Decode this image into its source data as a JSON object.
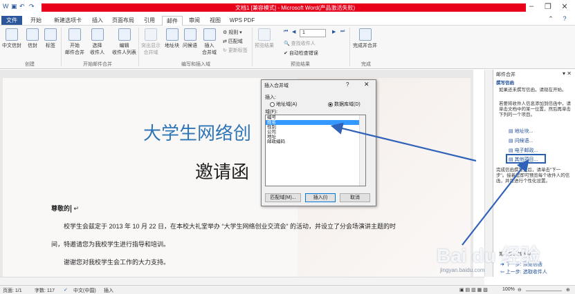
{
  "titlebar": {
    "title": "文档1 [兼容模式] - Microsoft Word(产品激活失败)",
    "accent": "#e8001a"
  },
  "tabs": [
    "文件",
    "开始",
    "新建选项卡",
    "插入",
    "页面布局",
    "引用",
    "邮件",
    "审阅",
    "视图",
    "WPS PDF"
  ],
  "active_tab": "邮件",
  "ribbon": {
    "create": {
      "btn1": "中文信封",
      "btn2": "信封",
      "btn3": "标签",
      "group": "创建"
    },
    "start": {
      "btn1": "开始",
      "btn1b": "邮件合并",
      "btn2": "选择",
      "btn2b": "收件人",
      "btn3": "编辑",
      "btn3b": "收件人列表",
      "group": "开始邮件合并"
    },
    "write": {
      "btn1": "突出显示",
      "btn1b": "合并域",
      "btn2": "地址块",
      "btn3": "问候语",
      "btn4": "插入",
      "btn4b": "合并域",
      "rules": "规则",
      "match": "匹配域",
      "update": "更新标签",
      "group": "编写和插入域"
    },
    "preview": {
      "btn1": "预览结果",
      "record": "1",
      "find": "查找收件人",
      "check": "自动检查错误",
      "group": "预览结果"
    },
    "finish": {
      "btn1": "完成并合并",
      "group": "完成"
    }
  },
  "document": {
    "title": "大学生网络创",
    "subtitle": "邀请函",
    "salutation": "尊敬的",
    "line1": "校学生会兹定于 2013 年 10 月 22 日，在本校大礼堂举办 “大学生网络创业交流会” 的活动，并设立了分会场演讲主题的时",
    "line2": "间，特邀请您为我校学生进行指导和培训。",
    "line3": "谢谢您对我校学生会工作的大力支持。"
  },
  "dialog": {
    "title": "插入合并域",
    "help": "?",
    "close": "✕",
    "insert_label": "插入:",
    "radio_address": "地址域(A)",
    "radio_db": "数据库域(D)",
    "fields_label": "域(F):",
    "fields": [
      "编号",
      "姓名",
      "性别",
      "公司",
      "地址",
      "邮政编码"
    ],
    "selected_index": 1,
    "btn_match": "匹配域(M)...",
    "btn_insert": "插入(I)",
    "btn_cancel": "取消"
  },
  "pane": {
    "title": "邮件合并",
    "heading": "撰写信函",
    "intro": "如果还未撰写信函，请现在开始。",
    "instruction": "若要将收件人信息添加到信函中，请单击文档中的某一位置，然后再单击下列的一个项目。",
    "link1": "地址块...",
    "link2": "问候语...",
    "link3": "电子邮政...",
    "link4": "其他项目...",
    "after": "完成信函撰写之后，请单击\"下一步\"。接着您即可预览每个收件人的信函，并可进行个性化设置。",
    "step": "第 4 步，共 6 步",
    "next": "下一步: 预览信函",
    "prev": "上一步: 选取收件人"
  },
  "statusbar": {
    "page": "页面: 1/1",
    "words": "字数: 117",
    "lang": "中文(中国)",
    "mode": "插入",
    "zoom": "100%"
  },
  "watermark": {
    "logo": "Bai du 经验",
    "url": "jingyan.baidu.com"
  }
}
